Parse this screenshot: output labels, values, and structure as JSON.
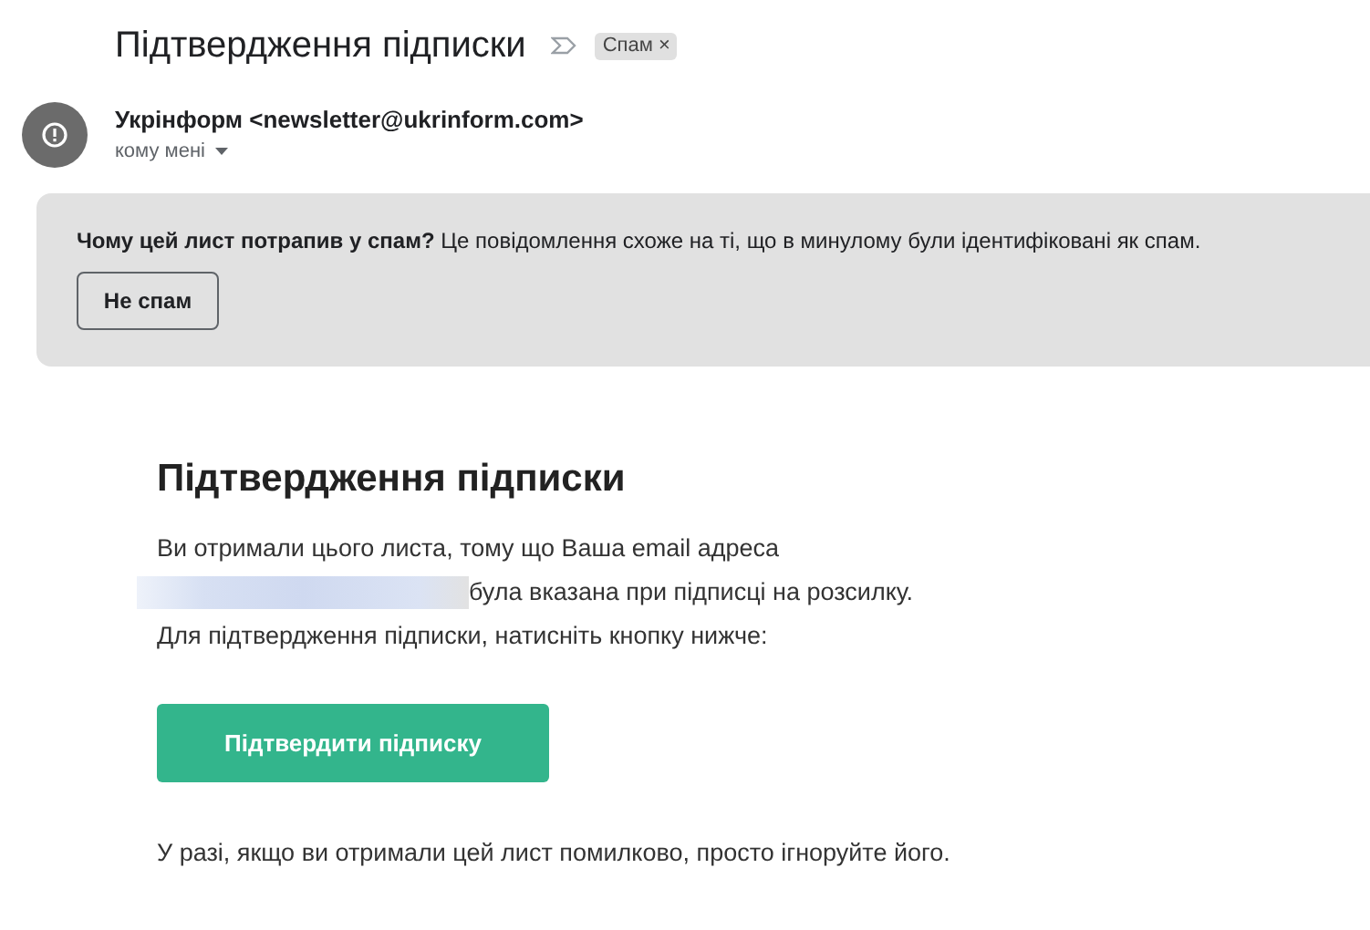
{
  "subject": "Підтвердження підписки",
  "label": {
    "text": "Спам",
    "close": "×"
  },
  "sender": {
    "name": "Укрінформ <newsletter@ukrinform.com>",
    "recipient": "кому мені"
  },
  "spam_notice": {
    "text": "**Чому цей лист потрапив у спам?** Це повідомлення схоже на ті, що в минулому були ідентифіковані як спам.",
    "button": "Не спам"
  },
  "body": {
    "heading": "Підтвердження підписки",
    "lines": [
      {
        "kind": "text",
        "text": "Ви отримали цього листа, тому що Ваша email адреса"
      },
      {
        "kind": "redacted",
        "text": "була вказана при підписці на розсилку."
      },
      {
        "kind": "text",
        "text": "Для підтвердження підписки, натисніть кнопку нижче:"
      }
    ],
    "button": "Підтвердити підписку",
    "footer": "У разі, якщо ви отримали цей лист помилково, просто ігноруйте його."
  }
}
